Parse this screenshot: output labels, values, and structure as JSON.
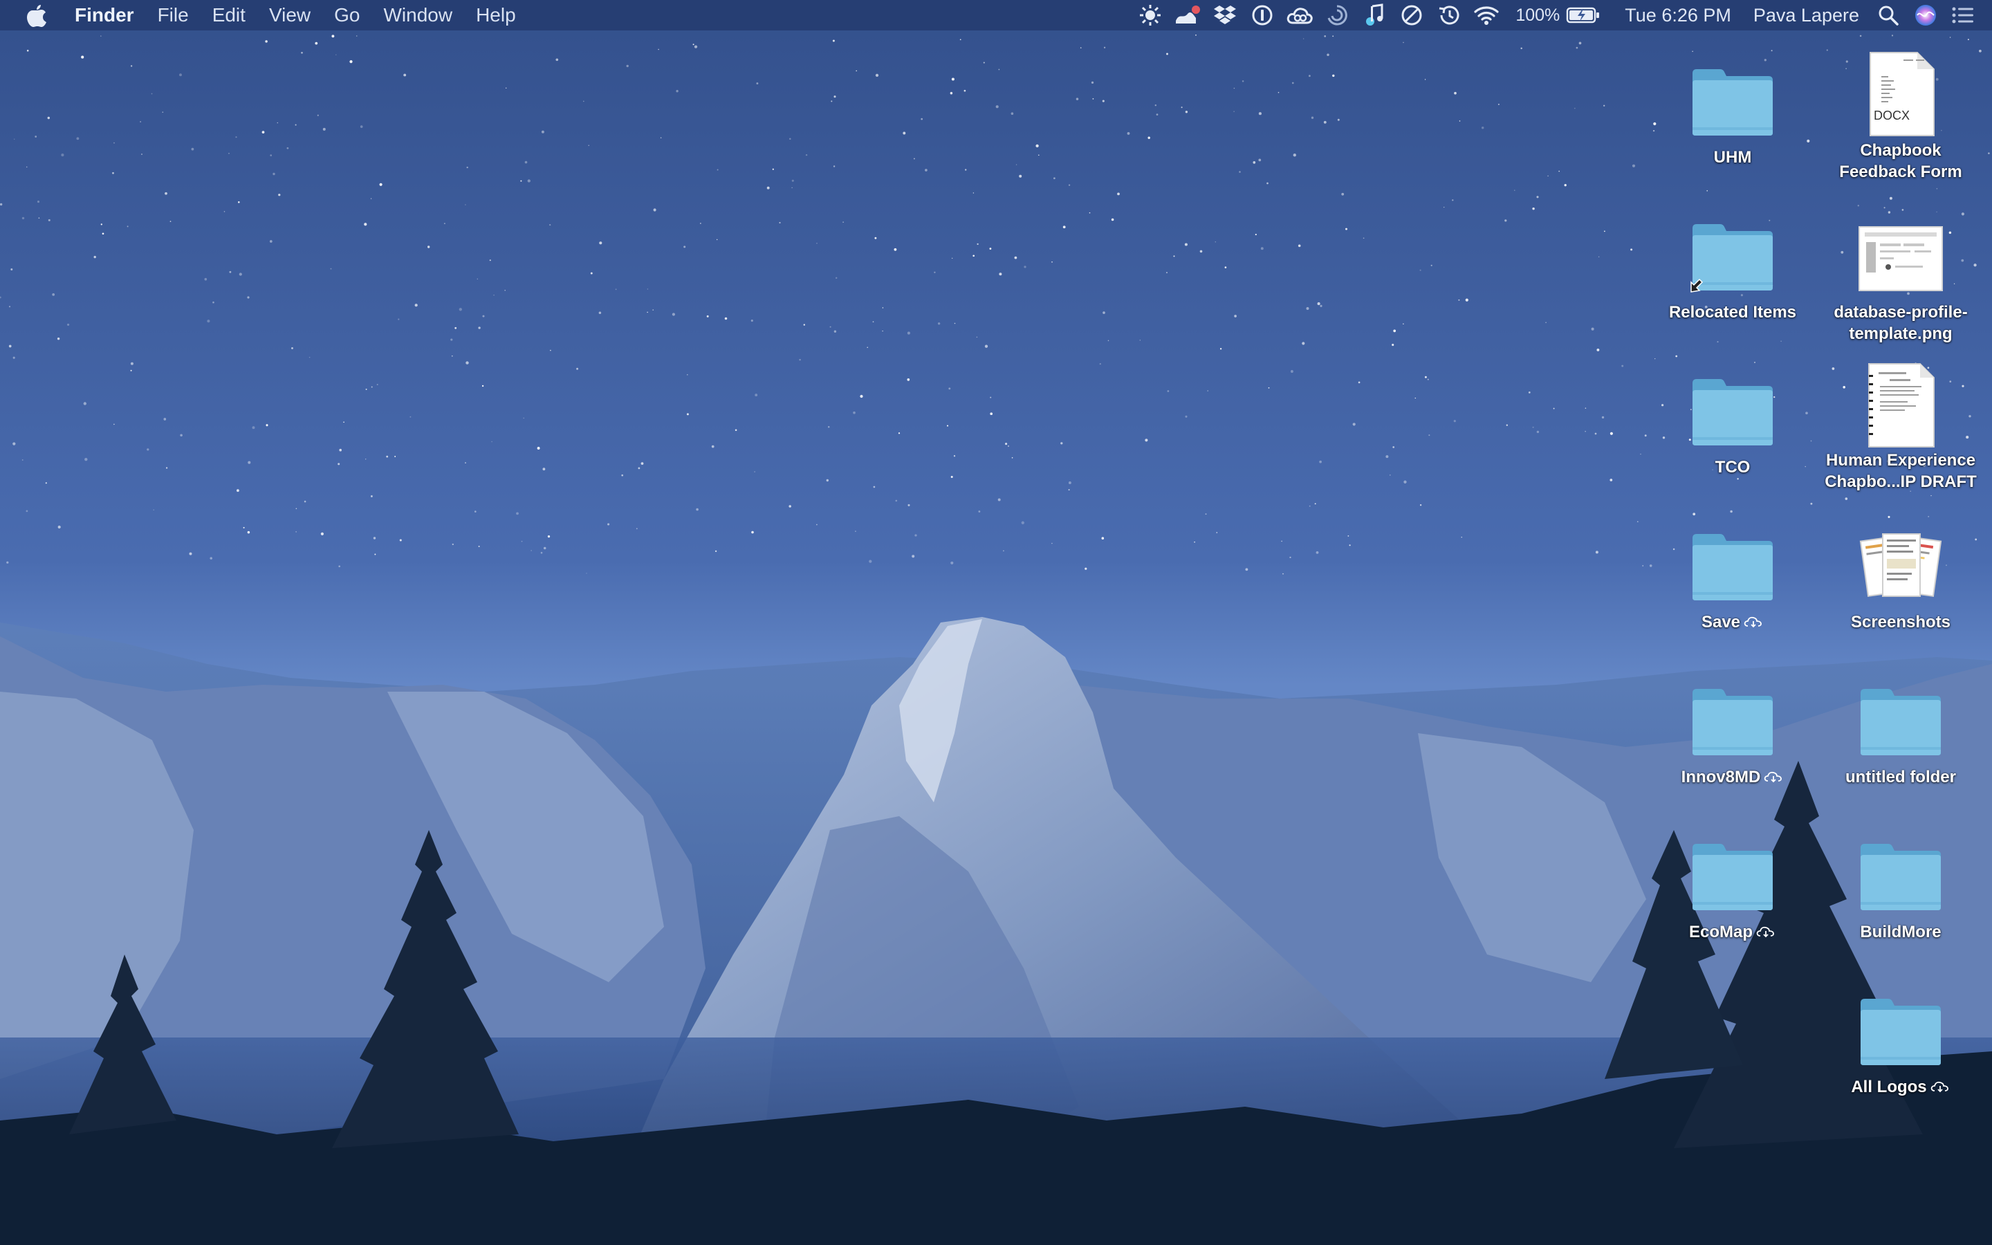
{
  "menubar": {
    "apple_icon": "apple-logo-icon",
    "app_name": "Finder",
    "menus": [
      "File",
      "Edit",
      "View",
      "Go",
      "Window",
      "Help"
    ],
    "status_icons": [
      "sun-icon",
      "app-badge-icon",
      "dropbox-icon",
      "1password-icon",
      "creative-cloud-icon",
      "sync-icon",
      "music-app-icon",
      "do-not-disturb-icon",
      "time-machine-icon",
      "wifi-icon"
    ],
    "battery_percent": "100%",
    "battery_level": 1.0,
    "datetime": "Tue 6:26 PM",
    "user_name": "Pava Lapere",
    "trailing_icons": [
      "spotlight-icon",
      "siri-icon",
      "notification-center-icon"
    ]
  },
  "desktop": {
    "items": [
      {
        "name": "UHM",
        "kind": "folder",
        "cloud": false
      },
      {
        "name": "Chapbook\nFeedback Form",
        "kind": "docx",
        "cloud": false,
        "badge": "DOCX"
      },
      {
        "name": "Relocated Items",
        "kind": "folder-alias",
        "cloud": false
      },
      {
        "name": "database-profile-\ntemplate.png",
        "kind": "image",
        "cloud": false
      },
      {
        "name": "TCO",
        "kind": "folder",
        "cloud": false
      },
      {
        "name": "Human Experience\nChapbo...IP DRAFT",
        "kind": "document",
        "cloud": false
      },
      {
        "name": "Save",
        "kind": "folder",
        "cloud": true
      },
      {
        "name": "Screenshots",
        "kind": "stack",
        "cloud": false
      },
      {
        "name": "Innov8MD",
        "kind": "folder",
        "cloud": true
      },
      {
        "name": "untitled folder",
        "kind": "folder",
        "cloud": false
      },
      {
        "name": "EcoMap",
        "kind": "folder",
        "cloud": true
      },
      {
        "name": "BuildMore",
        "kind": "folder",
        "cloud": false
      },
      {
        "name": "All Logos",
        "kind": "folder",
        "cloud": true
      }
    ]
  },
  "colors": {
    "folder_body": "#7fc4e6",
    "folder_tab": "#5aa6d1",
    "menubar_text": "#e6ecf7"
  }
}
